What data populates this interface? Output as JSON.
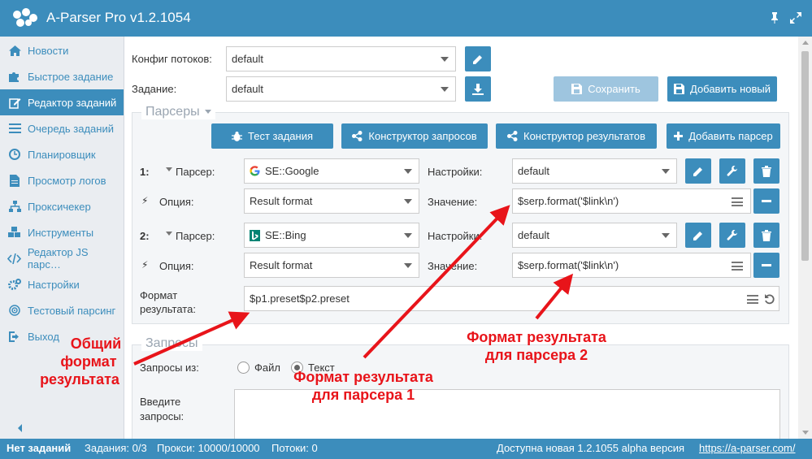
{
  "app": {
    "title": "A-Parser Pro v1.2.1054"
  },
  "sidebar": {
    "items": [
      {
        "label": "Новости",
        "icon": "home-icon"
      },
      {
        "label": "Быстрое задание",
        "icon": "puzzle-icon"
      },
      {
        "label": "Редактор заданий",
        "icon": "edit-icon",
        "active": true
      },
      {
        "label": "Очередь заданий",
        "icon": "list-icon"
      },
      {
        "label": "Планировщик",
        "icon": "clock-icon"
      },
      {
        "label": "Просмотр логов",
        "icon": "file-icon"
      },
      {
        "label": "Проксичекер",
        "icon": "sitemap-icon"
      },
      {
        "label": "Инструменты",
        "icon": "cubes-icon"
      },
      {
        "label": "Редактор JS парс…",
        "icon": "code-icon"
      },
      {
        "label": "Настройки",
        "icon": "cogs-icon"
      },
      {
        "label": "Тестовый парсинг",
        "icon": "target-icon"
      },
      {
        "label": "Выход",
        "icon": "logout-icon"
      }
    ]
  },
  "top": {
    "threads_label": "Конфиг потоков:",
    "threads_value": "default",
    "task_label": "Задание:",
    "task_value": "default",
    "save_label": "Сохранить",
    "add_new_label": "Добавить новый"
  },
  "parsers": {
    "legend": "Парсеры",
    "test_label": "Тест задания",
    "query_builder_label": "Конструктор запросов",
    "result_builder_label": "Конструктор результатов",
    "add_parser_label": "Добавить парсер",
    "parser_label": "Парсер:",
    "settings_label": "Настройки:",
    "option_label": "Опция:",
    "value_label": "Значение:",
    "rows": [
      {
        "num": "1:",
        "parser": "SE::Google",
        "settings": "default",
        "option": "Result format",
        "value": "$serp.format('$link\\n')"
      },
      {
        "num": "2:",
        "parser": "SE::Bing",
        "settings": "default",
        "option": "Result format",
        "value": "$serp.format('$link\\n')"
      }
    ],
    "result_format_label_1": "Формат",
    "result_format_label_2": "результата:",
    "result_format_value": "$p1.preset$p2.preset"
  },
  "queries": {
    "legend": "Запросы",
    "from_label": "Запросы из:",
    "file_label": "Файл",
    "text_label": "Текст",
    "enter_label_1": "Введите",
    "enter_label_2": "запросы:"
  },
  "annotations": {
    "common_1": "Общий",
    "common_2": "формат",
    "common_3": "результата",
    "p1_1": "Формат результата",
    "p1_2": "для парсера 1",
    "p2_1": "Формат результата",
    "p2_2": "для парсера 2"
  },
  "status": {
    "no_tasks": "Нет заданий",
    "tasks": "Задания: 0/3",
    "proxy": "Прокси: 10000/10000",
    "threads": "Потоки: 0",
    "update": "Доступна новая 1.2.1055 alpha версия",
    "link": "https://a-parser.com/"
  },
  "colors": {
    "accent": "#3c8dbc",
    "annotation": "#e8141a",
    "google_blue": "#4285f4",
    "bing_teal": "#008373"
  }
}
